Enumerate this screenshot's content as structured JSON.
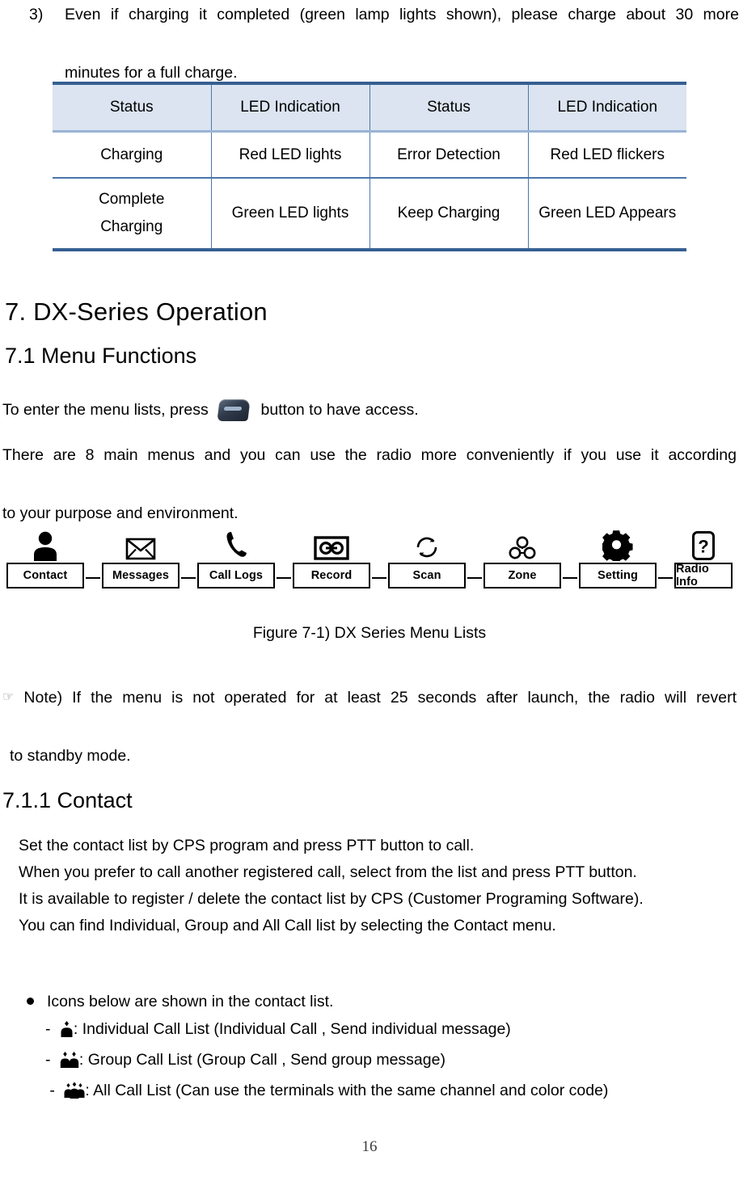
{
  "document": {
    "page_number": "16"
  },
  "item3": {
    "marker": "3)",
    "line1": "Even if charging it completed (green lamp lights shown), please charge about 30 more",
    "line2": "minutes for a full charge."
  },
  "status_table": {
    "headers": [
      "Status",
      "LED Indication",
      "Status",
      "LED Indication"
    ],
    "rows": [
      [
        "Charging",
        "Red LED lights",
        "Error Detection",
        "Red LED flickers"
      ],
      [
        "Complete Charging",
        "Green LED lights",
        "Keep Charging",
        "Green LED Appears"
      ]
    ],
    "row2_col1_line1": "Complete",
    "row2_col1_line2": "Charging",
    "colors": {
      "header_fill": "#dbe4f0",
      "rule_dark": "#365f91",
      "rule_light": "#4a76ac"
    }
  },
  "headings": {
    "chapter": "7. DX-Series Operation",
    "section": "7.1  Menu  Functions",
    "subsection": "7.1.1 Contact"
  },
  "paragraphs": {
    "menu_enter_pre": "To enter the menu lists, press",
    "menu_enter_post": "button to have access.",
    "eight_menus_line1": "There are 8 main menus and you can use the radio more conveniently if you use it according",
    "eight_menus_line2": "to your purpose and environment."
  },
  "menu_flow": {
    "nodes": [
      {
        "label": "Contact",
        "icon": "person-icon"
      },
      {
        "label": "Messages",
        "icon": "envelope-icon"
      },
      {
        "label": "Call Logs",
        "icon": "phone-handset-icon"
      },
      {
        "label": "Record",
        "icon": "cassette-tape-icon"
      },
      {
        "label": "Scan",
        "icon": "refresh-cycle-icon"
      },
      {
        "label": "Zone",
        "icon": "three-circles-icon"
      },
      {
        "label": "Setting",
        "icon": "gear-icon"
      },
      {
        "label": "Radio Info",
        "icon": "question-mark-icon"
      }
    ]
  },
  "figure": {
    "caption": "Figure 7-1) DX Series Menu Lists"
  },
  "note": {
    "hand_icon": "pointing-hand-icon",
    "line1": "Note) If the menu is not operated for at least 25 seconds after launch, the radio will revert",
    "line2": "to standby mode."
  },
  "contact_section": {
    "lines": [
      "Set the contact list by CPS program and press PTT button to call.",
      "When you prefer to call another registered call, select from the list and press PTT button.",
      "It is available to register / delete the contact list by CPS (Customer Programing Software).",
      "You can find Individual, Group and All Call list by selecting the Contact menu."
    ],
    "bullet_heading": "Icons below are shown in the contact list.",
    "icon_items": [
      {
        "dash": "-",
        "icon": "individual-person-icon",
        "text": ": Individual Call List (Individual Call , Send individual message)"
      },
      {
        "dash": "-",
        "icon": "group-people-icon",
        "text": ": Group Call List   (Group Call , Send group message)"
      },
      {
        "dash": "-",
        "icon": "all-call-people-icon",
        "text": ": All Call List (Can use the terminals with the same channel and color code)"
      }
    ]
  }
}
